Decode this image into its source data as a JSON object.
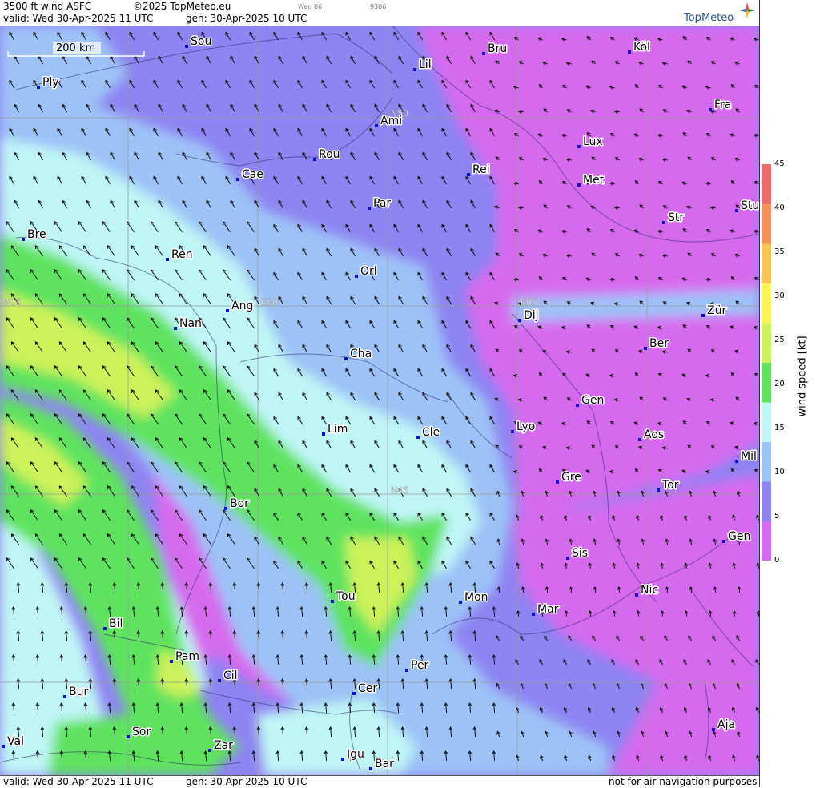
{
  "header": {
    "title": "3500 ft wind ASFC",
    "copyright": "©2025 TopMeteo.eu",
    "valid": "valid:  Wed  30-Apr-2025  11 UTC",
    "gen": "gen: 30-Apr-2025 10 UTC",
    "day_tab": "Wed 06",
    "code": "9306",
    "brand": "TopMeteo"
  },
  "scale_bar": {
    "label": "200 km"
  },
  "grid_labels": [
    "W05",
    "E00",
    "E05",
    "N50",
    "N45"
  ],
  "cities": [
    {
      "name": "Sou"
    },
    {
      "name": "Ply"
    },
    {
      "name": "Lil"
    },
    {
      "name": "Bru"
    },
    {
      "name": "Köl"
    },
    {
      "name": "Ami"
    },
    {
      "name": "Fra"
    },
    {
      "name": "Rou"
    },
    {
      "name": "Lux"
    },
    {
      "name": "Cae"
    },
    {
      "name": "Rei"
    },
    {
      "name": "Met"
    },
    {
      "name": "Par"
    },
    {
      "name": "Stu"
    },
    {
      "name": "Str"
    },
    {
      "name": "Bre"
    },
    {
      "name": "Ren"
    },
    {
      "name": "Orl"
    },
    {
      "name": "Ang"
    },
    {
      "name": "Zür"
    },
    {
      "name": "Dij"
    },
    {
      "name": "Nan"
    },
    {
      "name": "Ber"
    },
    {
      "name": "Cha"
    },
    {
      "name": "Gen"
    },
    {
      "name": "Lim"
    },
    {
      "name": "Cle"
    },
    {
      "name": "Lyo"
    },
    {
      "name": "Aos"
    },
    {
      "name": "Mil"
    },
    {
      "name": "Gre"
    },
    {
      "name": "Tor"
    },
    {
      "name": "Bor"
    },
    {
      "name": "Gen"
    },
    {
      "name": "Sis"
    },
    {
      "name": "Tou"
    },
    {
      "name": "Mon"
    },
    {
      "name": "Nic"
    },
    {
      "name": "Mar"
    },
    {
      "name": "Bil"
    },
    {
      "name": "Pam"
    },
    {
      "name": "Per"
    },
    {
      "name": "Cil"
    },
    {
      "name": "Cer"
    },
    {
      "name": "Bur"
    },
    {
      "name": "Sor"
    },
    {
      "name": "Aja"
    },
    {
      "name": "Val"
    },
    {
      "name": "Zar"
    },
    {
      "name": "Igu"
    },
    {
      "name": "Bar"
    }
  ],
  "legend": {
    "title": "wind speed [kt]",
    "ticks": [
      "45",
      "40",
      "35",
      "30",
      "25",
      "20",
      "15",
      "10",
      "5",
      "0"
    ],
    "colors": [
      "#d66aef",
      "#8e84f2",
      "#9cc2f6",
      "#bff5f5",
      "#5fe35f",
      "#cdf25a",
      "#fbf253",
      "#fbc450",
      "#f8905a",
      "#ef6a6a"
    ]
  },
  "footer": {
    "valid": "valid:  Wed  30-Apr-2025  11 UTC",
    "gen": "gen: 30-Apr-2025 10 UTC",
    "disclaimer": "not for air navigation purposes"
  }
}
